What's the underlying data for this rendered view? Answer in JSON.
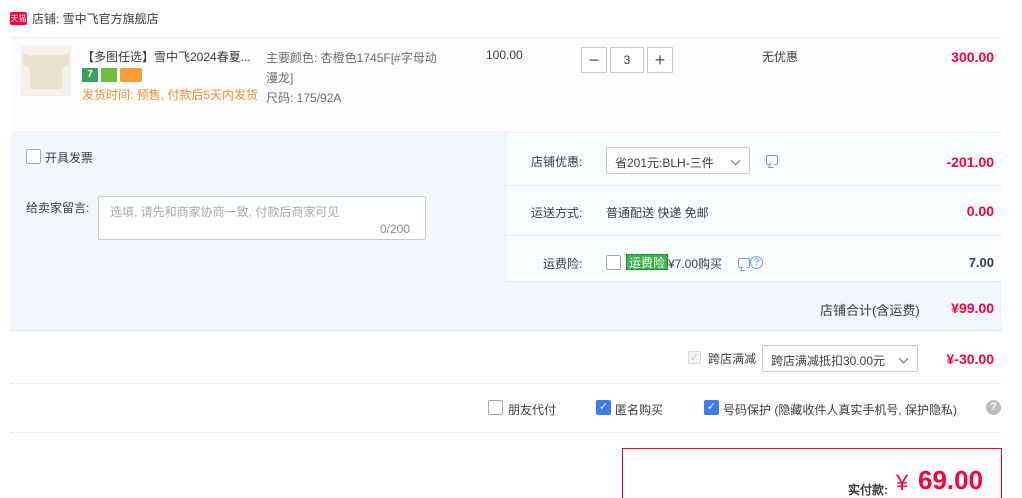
{
  "shop": {
    "logo_text": "天猫",
    "label": "店铺: 雪中飞官方旗舰店"
  },
  "item": {
    "title": "【多图任选】雪中飞2024春夏...",
    "badges": [
      "7",
      "",
      ""
    ],
    "delivery": "发货时间: 预售, 付款后5天内发货",
    "spec_color": "主要颜色: 杏橙色1745F[#字母动漫龙]",
    "spec_size": "尺码: 175/92A",
    "price": "100.00",
    "quantity": "3",
    "qty_minus": "−",
    "qty_plus": "+",
    "discount": "无优惠",
    "total": "300.00"
  },
  "options": {
    "invoice_label": "开具发票",
    "message_label": "给卖家留言:",
    "message_placeholder": "选填, 请先和商家协商一致, 付款后商家可见",
    "message_count": "0/200",
    "coupon_label": "店铺优惠:",
    "coupon_value": "省201元:BLH-三件",
    "coupon_amount": "-201.00",
    "shipping_label": "运送方式:",
    "shipping_value": "普通配送 快递 免邮",
    "shipping_amount": "0.00",
    "insurance_label": "运费险:",
    "insurance_tag": "运费险",
    "insurance_price": "¥7.00购买",
    "insurance_amount": "7.00",
    "subtotal_label": "店铺合计(含运费)",
    "subtotal_amount": "¥99.00"
  },
  "cross_store": {
    "label": "跨店满减",
    "select_value": "跨店满减抵扣30.00元",
    "amount": "¥-30.00"
  },
  "services": {
    "friend_pay": "朋友代付",
    "anonymous": "匿名购买",
    "phone_protect": "号码保护 (隐藏收件人真实手机号, 保护隐私)"
  },
  "payment": {
    "label": "实付款:",
    "currency": "¥",
    "amount": "69.00"
  },
  "colors": {
    "accent": "#ff0036",
    "checkbox_blue": "#3e7af5",
    "panel_bg": "#f2f7ff",
    "delivery_orange": "#ef8f28"
  }
}
